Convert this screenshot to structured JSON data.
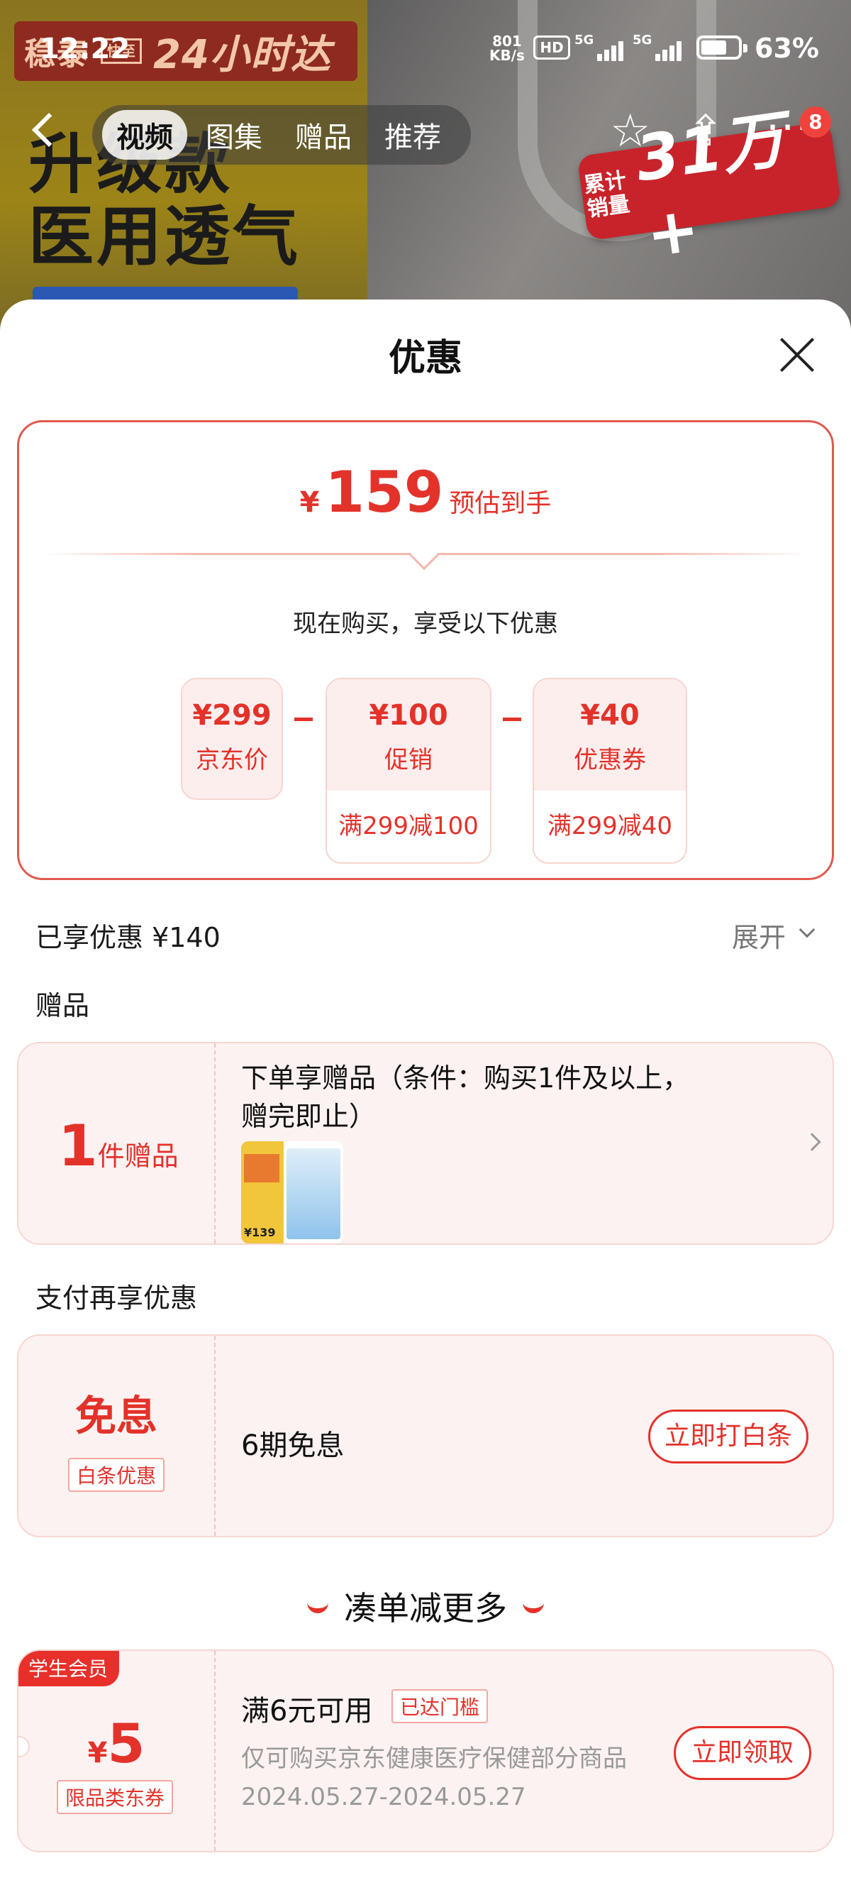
{
  "status_bar": {
    "time": "12:22",
    "net_speed_value": "801",
    "net_speed_unit": "KB/s",
    "hd": "HD",
    "signal1": "5G",
    "signal2": "5G",
    "battery": "63%"
  },
  "hero": {
    "brand": "稳泰",
    "brand_box": "快至",
    "brand_tagline": "24小时达",
    "headline1": "升级款",
    "headline2": "医用透气",
    "sales_small": "累计销量",
    "sales_big": "31万+"
  },
  "nav": {
    "tabs": [
      {
        "label": "视频",
        "active": true
      },
      {
        "label": "图集"
      },
      {
        "label": "赠品"
      },
      {
        "label": "推荐"
      }
    ],
    "more_badge": "8"
  },
  "sheet": {
    "title": "优惠",
    "estimate": {
      "currency": "¥",
      "value": "159",
      "label": "预估到手"
    },
    "buy_now": "现在购买，享受以下优惠",
    "breakdown": [
      {
        "amount": "¥299",
        "label": "京东价"
      },
      {
        "amount": "¥100",
        "label": "促销",
        "rule": "满299减100"
      },
      {
        "amount": "¥40",
        "label": "优惠券",
        "rule": "满299减40"
      }
    ],
    "saved": "已享优惠 ¥140",
    "expand": "展开",
    "gift_section": "赠品",
    "gift": {
      "count": "1",
      "count_unit": "件赠品",
      "desc": "下单享赠品（条件：购买1件及以上，赠完即止）",
      "thumb_price": "¥139"
    },
    "pay_section": "支付再享优惠",
    "pay": {
      "title": "免息",
      "tag": "白条优惠",
      "desc": "6期免息",
      "button": "立即打白条"
    },
    "more_title": "凑单减更多",
    "coupon": {
      "badge": "学生会员",
      "currency": "¥",
      "value": "5",
      "tag": "限品类东券",
      "condition": "满6元可用",
      "reached": "已达门槛",
      "scope": "仅可购买京东健康医疗保健部分商品",
      "dates": "2024.05.27-2024.05.27",
      "button": "立即领取"
    }
  },
  "colors": {
    "accent": "#e3322a",
    "card_bg": "#fdf2f2",
    "card_border": "#f7d6d2"
  }
}
